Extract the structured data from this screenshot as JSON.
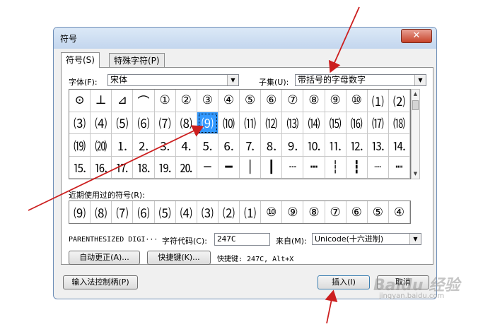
{
  "window": {
    "title": "符号",
    "close_label": "✕"
  },
  "tabs": [
    {
      "label": "符号(S)"
    },
    {
      "label": "特殊字符(P)"
    }
  ],
  "font": {
    "label": "字体(F):",
    "value": "宋体"
  },
  "subset": {
    "label": "子集(U):",
    "value": "带括号的字母数字"
  },
  "symbol_rows": [
    [
      "⊙",
      "⊥",
      "⊿",
      "⌒",
      "①",
      "②",
      "③",
      "④",
      "⑤",
      "⑥",
      "⑦",
      "⑧",
      "⑨",
      "⑩",
      "⑴",
      "⑵"
    ],
    [
      "⑶",
      "⑷",
      "⑸",
      "⑹",
      "⑺",
      "⑻",
      "⑼",
      "⑽",
      "⑾",
      "⑿",
      "⒀",
      "⒁",
      "⒂",
      "⒃",
      "⒄",
      "⒅"
    ],
    [
      "⒆",
      "⒇",
      "⒈",
      "⒉",
      "⒊",
      "⒋",
      "⒌",
      "⒍",
      "⒎",
      "⒏",
      "⒐",
      "⒑",
      "⒒",
      "⒓",
      "⒔",
      "⒕"
    ],
    [
      "⒖",
      "⒗",
      "⒘",
      "⒙",
      "⒚",
      "⒛",
      "─",
      "━",
      "│",
      "┃",
      "┄",
      "┅",
      "┆",
      "┇",
      "┈",
      "┉"
    ]
  ],
  "recent": {
    "label": "近期使用过的符号(R):",
    "items": [
      "⑼",
      "⑻",
      "⑺",
      "⑹",
      "⑸",
      "⑷",
      "⑶",
      "⑵",
      "⑴",
      "⑩",
      "⑨",
      "⑧",
      "⑦",
      "⑥",
      "⑤",
      "④"
    ]
  },
  "char_name": "PARENTHESIZED DIGI···",
  "char_code": {
    "label": "字符代码(C):",
    "value": "247C"
  },
  "from": {
    "label": "来自(M):",
    "value": "Unicode(十六进制)"
  },
  "buttons": {
    "autocorrect": "自动更正(A)...",
    "shortcut_key": "快捷键(K)...",
    "ime_handle": "输入法控制柄(P)",
    "insert": "插入(I)",
    "cancel": "取消"
  },
  "shortcut_text": "快捷键: 247C, Alt+X",
  "watermark": {
    "brand": "Baidu 经验",
    "url": "jingyan.baidu.com"
  },
  "colors": {
    "selected": "#3399ff",
    "arrow": "#cc1f1f"
  }
}
